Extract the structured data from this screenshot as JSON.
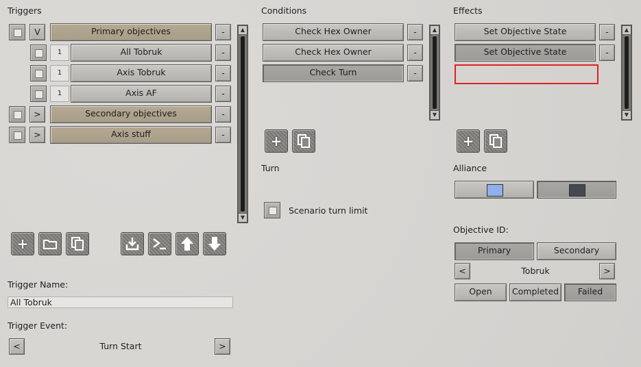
{
  "colors": {
    "alliance_allied": "#8fb0ea",
    "alliance_axis": "#44484f",
    "highlight": "#e02020"
  },
  "triggers": {
    "heading": "Triggers",
    "rows": [
      {
        "toggle": "V",
        "label": "Primary objectives",
        "minus": "-"
      },
      {
        "num": "1",
        "label": "All Tobruk",
        "minus": "-"
      },
      {
        "num": "1",
        "label": "Axis Tobruk",
        "minus": "-"
      },
      {
        "num": "1",
        "label": "Axis AF",
        "minus": "-"
      },
      {
        "toggle": ">",
        "label": "Secondary objectives",
        "minus": "-"
      },
      {
        "toggle": ">",
        "label": "Axis stuff",
        "minus": "-"
      }
    ],
    "toolbar_icons": [
      "add-icon",
      "folder-icon",
      "copy-icon",
      "import-icon",
      "script-icon",
      "move-up-icon",
      "move-down-icon"
    ],
    "name_label": "Trigger Name:",
    "name_value": "All Tobruk",
    "event_label": "Trigger Event:",
    "event_prev": "<",
    "event_value": "Turn Start",
    "event_next": ">"
  },
  "conditions": {
    "heading": "Conditions",
    "rows": [
      {
        "label": "Check Hex Owner",
        "minus": "-"
      },
      {
        "label": "Check Hex Owner",
        "minus": "-"
      },
      {
        "label": "Check Turn",
        "minus": "-"
      }
    ],
    "turn_heading": "Turn",
    "turn_limit_label": "Scenario turn limit"
  },
  "effects": {
    "heading": "Effects",
    "rows": [
      {
        "label": "Set Objective State",
        "minus": "-"
      },
      {
        "label": "Set Objective State",
        "minus": "-"
      }
    ],
    "alliance_heading": "Alliance",
    "objective_heading": "Objective ID:",
    "objective_tabs": [
      "Primary",
      "Secondary"
    ],
    "objective_prev": "<",
    "objective_value": "Tobruk",
    "objective_next": ">",
    "states": [
      "Open",
      "Completed",
      "Failed"
    ]
  }
}
